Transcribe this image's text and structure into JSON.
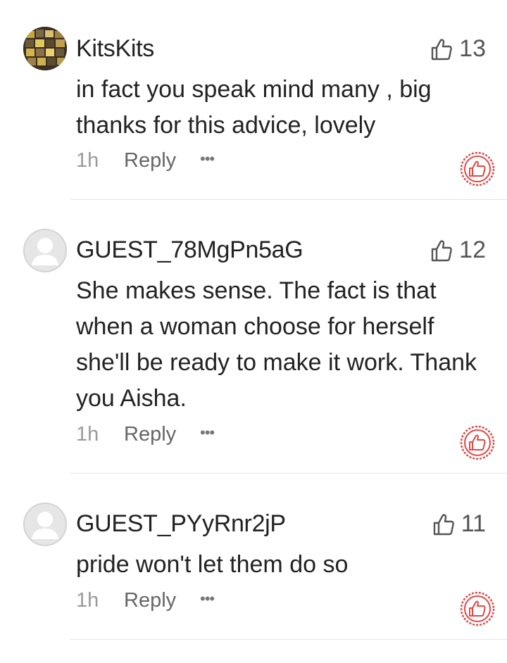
{
  "comments": [
    {
      "username": "KitsKits",
      "likes": "13",
      "text": "in fact you speak mind  many , big thanks for this advice, lovely",
      "time": "1h",
      "reply_label": "Reply",
      "more_label": "•••",
      "avatar_icon": "user-photo-avatar"
    },
    {
      "username": "GUEST_78MgPn5aG",
      "likes": "12",
      "text": "She makes sense. The fact is that when a woman choose for herself she'll be ready to make it work. Thank you Aisha.",
      "time": "1h",
      "reply_label": "Reply",
      "more_label": "•••",
      "avatar_icon": "guest-avatar"
    },
    {
      "username": "GUEST_PYyRnr2jP",
      "likes": "11",
      "text": "pride won't let them do so",
      "time": "1h",
      "reply_label": "Reply",
      "more_label": "•••",
      "avatar_icon": "guest-avatar"
    }
  ],
  "icons": {
    "like": "thumbs-up-outline-icon",
    "reaction": "red-stamp-thumbs-up-icon"
  },
  "colors": {
    "reaction_red": "#e04848",
    "text": "#222222",
    "muted": "#9a9a9a"
  }
}
